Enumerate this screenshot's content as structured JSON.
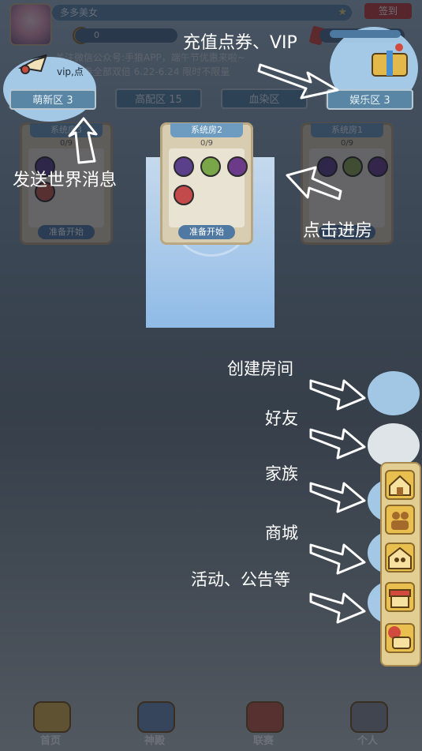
{
  "top": {
    "username": "多多美女",
    "checkin_label": "签到",
    "coins": "0",
    "tickets": "0"
  },
  "notice": {
    "line1": "关注微信公众号:手狼APP，端午节优惠来啦~",
    "line2": "vip,点券全部双倍  6.22-6.24 限时不限量"
  },
  "tabs": [
    {
      "label": "萌新区 3"
    },
    {
      "label": "高配区 15"
    },
    {
      "label": "血染区"
    },
    {
      "label": "娱乐区 3"
    }
  ],
  "rooms": [
    {
      "title": "系统房3",
      "count": "0/9",
      "ready": "准备开始"
    },
    {
      "title": "系统房2",
      "count": "0/9",
      "ready": "准备开始"
    },
    {
      "title": "系统房1",
      "count": "0/9",
      "ready": "准备开始"
    }
  ],
  "annotations": {
    "recharge_vip": "充值点券、VIP",
    "world_message": "发送世界消息",
    "enter_room": "点击进房",
    "create_room": "创建房间",
    "friends": "好友",
    "family": "家族",
    "shop": "商城",
    "events": "活动、公告等"
  },
  "bottom_nav": [
    {
      "label": "首页",
      "icon": "home-emblem-icon"
    },
    {
      "label": "神殿",
      "icon": "temple-emblem-icon"
    },
    {
      "label": "联赛",
      "icon": "league-emblem-icon"
    },
    {
      "label": "个人",
      "icon": "profile-emblem-icon"
    }
  ],
  "colors": {
    "tab_blue": "#5a86a6",
    "highlight_blue": "#aed6f5",
    "checkin_red": "#c43c3c"
  }
}
